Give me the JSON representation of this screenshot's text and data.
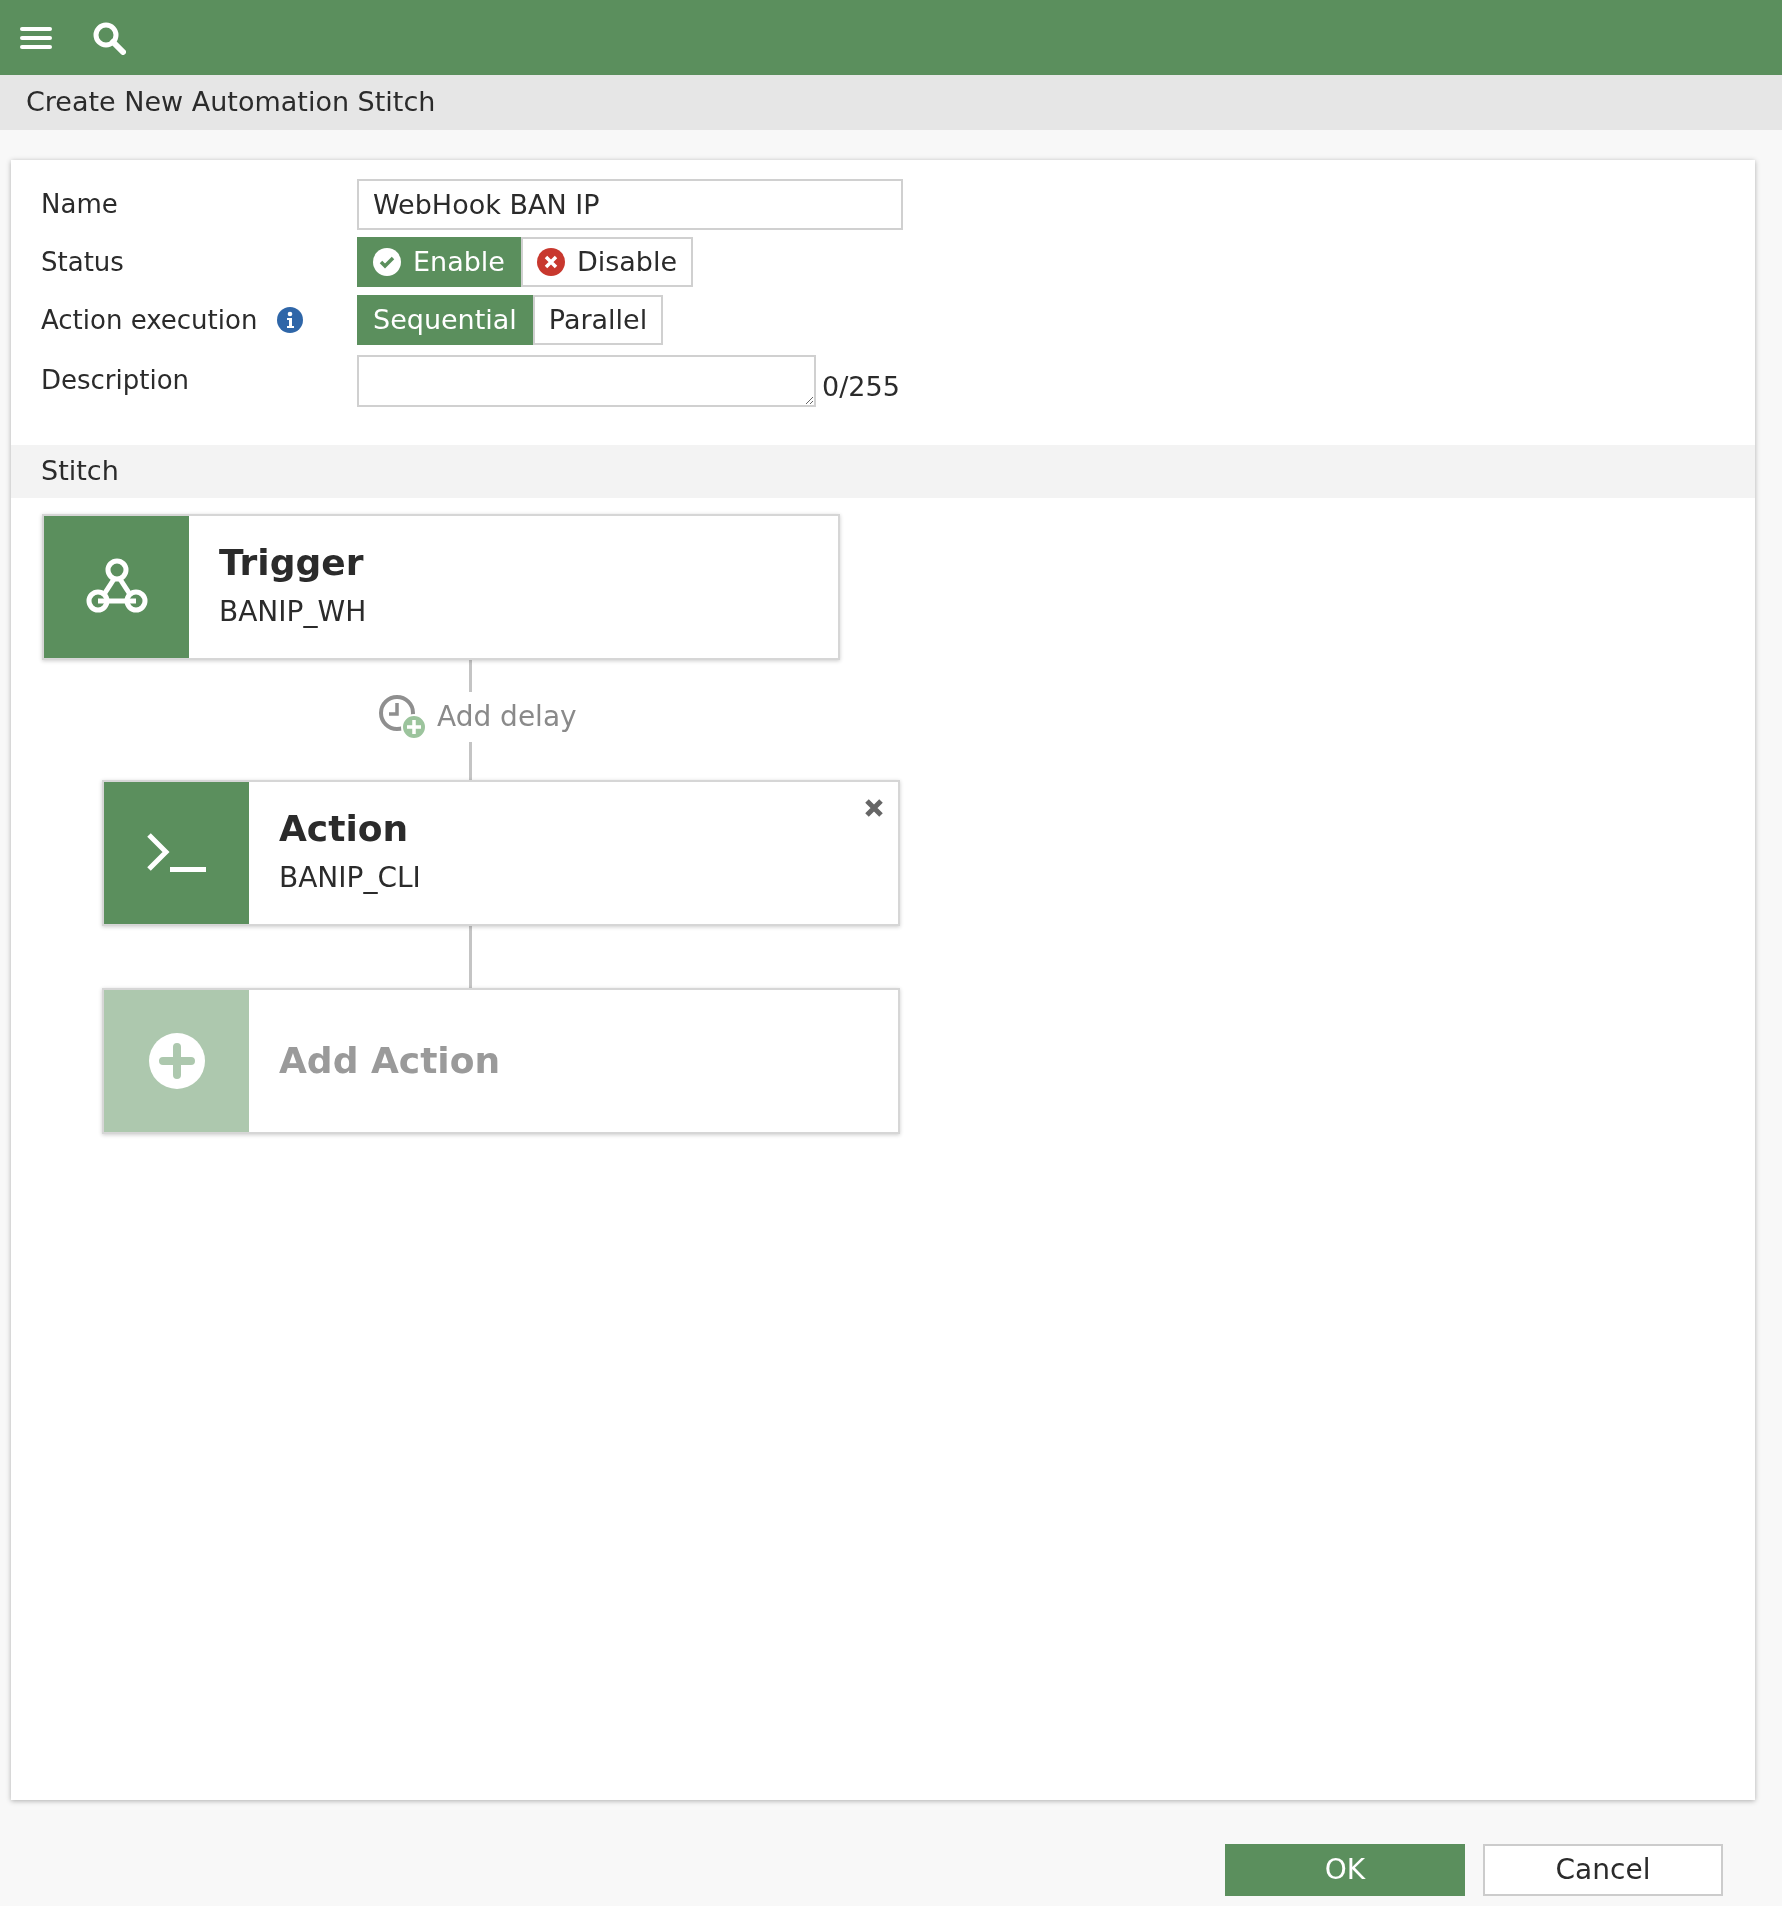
{
  "title": "Create New Automation Stitch",
  "form": {
    "name": {
      "label": "Name",
      "value": "WebHook BAN IP"
    },
    "status": {
      "label": "Status",
      "options": [
        {
          "label": "Enable",
          "kind": "enable",
          "selected": true
        },
        {
          "label": "Disable",
          "kind": "disable",
          "selected": false
        }
      ]
    },
    "action_execution": {
      "label": "Action execution",
      "options": [
        {
          "label": "Sequential",
          "selected": true
        },
        {
          "label": "Parallel",
          "selected": false
        }
      ]
    },
    "description": {
      "label": "Description",
      "counter": "0/255"
    }
  },
  "stitch": {
    "title": "Stitch",
    "nodes": [
      {
        "kind": "trigger",
        "title": "Trigger",
        "subtitle": "BANIP_WH"
      },
      {
        "kind": "delay",
        "label": "Add delay"
      },
      {
        "kind": "action",
        "title": "Action",
        "subtitle": "BANIP_CLI",
        "removable": true
      },
      {
        "kind": "add",
        "title": "Add Action"
      }
    ]
  },
  "buttons": [
    {
      "label": "OK",
      "primary": true
    },
    {
      "label": "Cancel",
      "primary": false
    }
  ]
}
